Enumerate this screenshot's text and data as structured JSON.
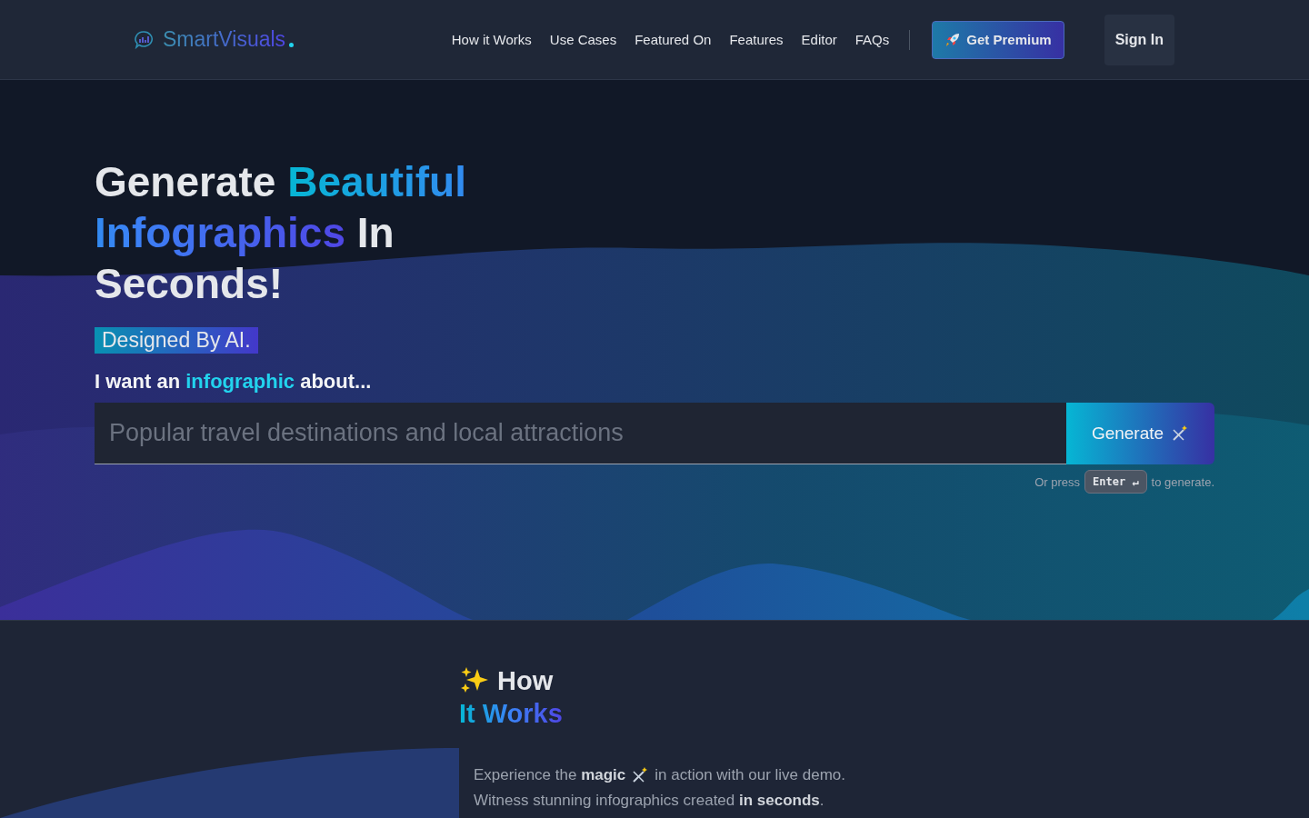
{
  "header": {
    "logo": "SmartVisuals",
    "nav": [
      {
        "label": "How it Works"
      },
      {
        "label": "Use Cases"
      },
      {
        "label": "Featured On"
      },
      {
        "label": "Features"
      },
      {
        "label": "Editor"
      },
      {
        "label": "FAQs"
      }
    ],
    "premium_button": "Get Premium",
    "sign_in_button": "Sign In"
  },
  "hero": {
    "headline": [
      {
        "text": "Generate ",
        "accent": false
      },
      {
        "text": "Beautiful Infographics",
        "accent": true
      },
      {
        "text": " In Seconds!",
        "accent": false
      }
    ],
    "badge": "Designed By AI.",
    "prompt_label": [
      {
        "text": "I want an ",
        "accent": false
      },
      {
        "text": "infographic",
        "accent": true
      },
      {
        "text": " about...",
        "accent": false
      }
    ],
    "input": {
      "placeholder": "Popular travel destinations and local attractions"
    },
    "generate_button": "Generate",
    "hint_before": "Or press",
    "key": "Enter ↵",
    "hint_after": "to generate."
  },
  "how_it_works": {
    "title_first": "How",
    "title_second": "It Works",
    "text_before": "Experience the **magic**",
    "text_after": "in action with our live demo.",
    "text_line2": "Witness stunning infographics created **in seconds**."
  }
}
